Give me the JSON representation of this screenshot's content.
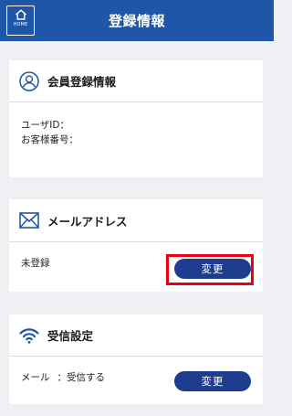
{
  "header": {
    "title": "登録情報",
    "home_label": "HOME"
  },
  "member_card": {
    "title": "会員登録情報",
    "user_id_label": "ユーザID：",
    "customer_no_label": "お客様番号："
  },
  "mail_card": {
    "title": "メールアドレス",
    "status": "未登録",
    "change_label": "変更"
  },
  "receive_card": {
    "title": "受信設定",
    "mail_label": "メール",
    "mail_value": "：受信する",
    "change_label": "変更"
  },
  "colors": {
    "header": "#1f56a7",
    "button": "#1e3d8f",
    "highlight": "#e60012",
    "background": "#eef0f4"
  }
}
